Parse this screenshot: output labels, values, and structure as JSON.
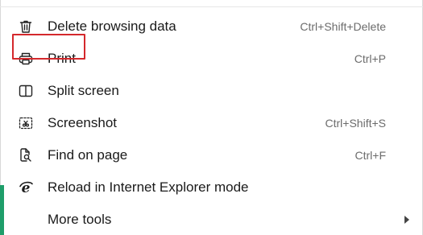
{
  "menu": {
    "items": [
      {
        "label": "Delete browsing data",
        "shortcut": "Ctrl+Shift+Delete",
        "icon": "trash-icon"
      },
      {
        "label": "Print",
        "shortcut": "Ctrl+P",
        "icon": "printer-icon"
      },
      {
        "label": "Split screen",
        "shortcut": "",
        "icon": "split-screen-icon"
      },
      {
        "label": "Screenshot",
        "shortcut": "Ctrl+Shift+S",
        "icon": "screenshot-icon"
      },
      {
        "label": "Find on page",
        "shortcut": "Ctrl+F",
        "icon": "find-icon"
      },
      {
        "label": "Reload in Internet Explorer mode",
        "shortcut": "",
        "icon": "internet-explorer-icon"
      },
      {
        "label": "More tools",
        "shortcut": "",
        "icon": "",
        "has_submenu": true
      }
    ]
  },
  "highlight": {
    "target": "Print",
    "color": "#d4282c"
  },
  "colors": {
    "accent_strip": "#1e9e6a",
    "text": "#1a1a1a",
    "shortcut": "#6b6b6b"
  }
}
